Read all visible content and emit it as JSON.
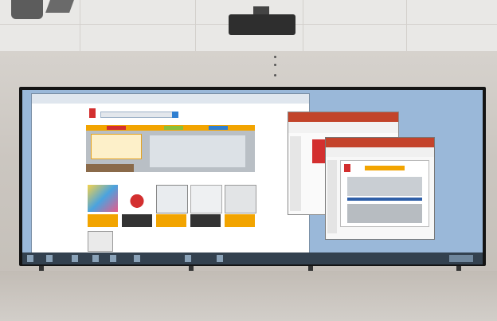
{
  "scene": {
    "title": "",
    "elements": [
      "ceiling-light",
      "projector",
      "interactive-whiteboard",
      "desktop-screen"
    ]
  },
  "colors": {
    "ceiling": "#e9e8e6",
    "wall": "#cbc6c0",
    "board_frame": "#141414",
    "desktop": "#9ab8d9",
    "taskbar": "#33414f",
    "accent_orange": "#f2a400",
    "accent_red": "#c2442a"
  }
}
